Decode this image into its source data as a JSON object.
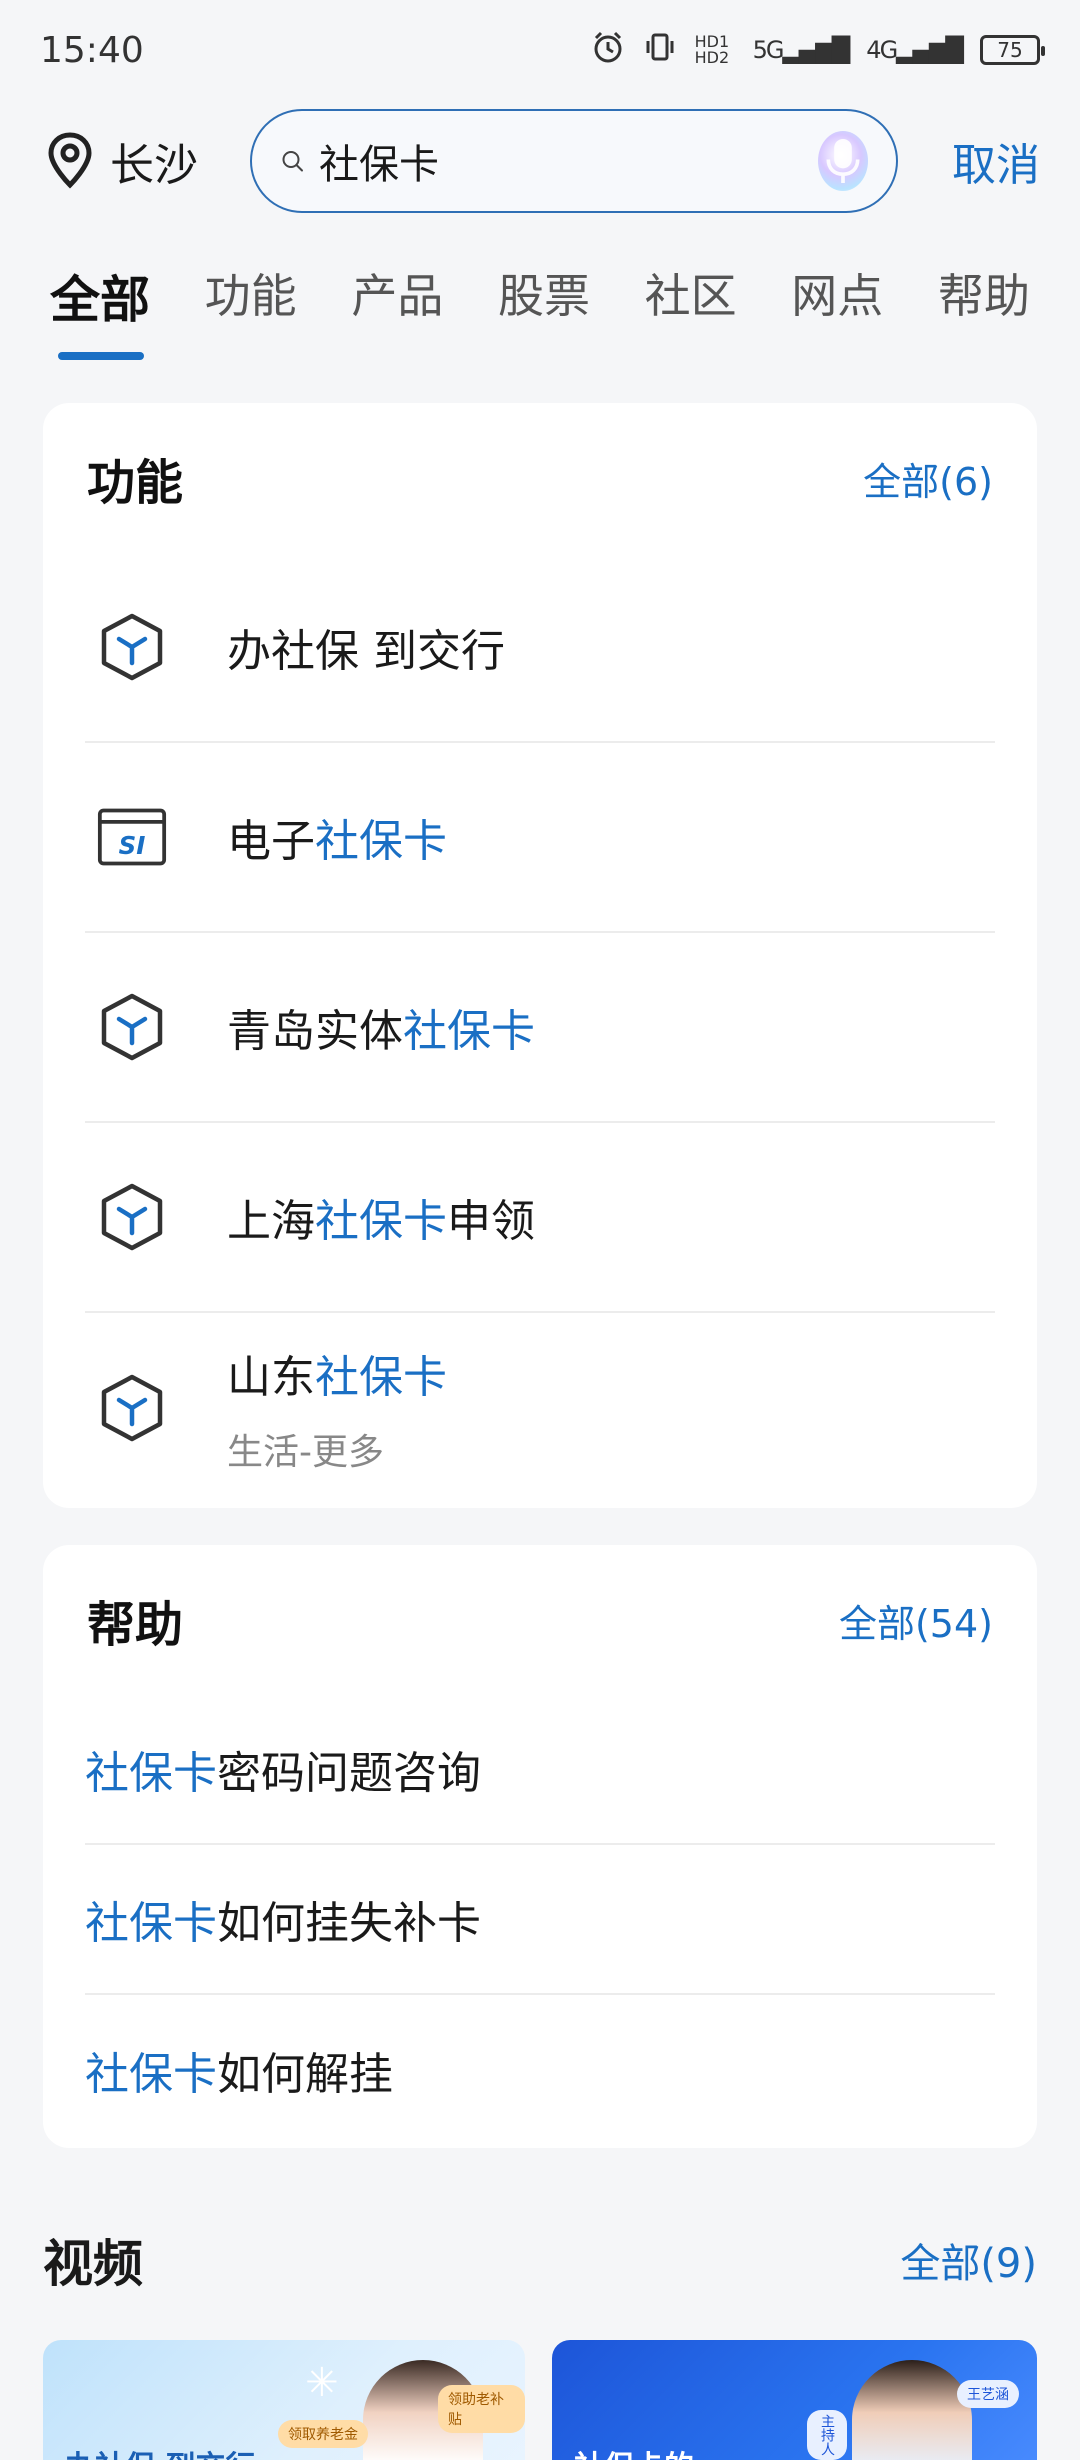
{
  "status": {
    "time": "15:40",
    "hd": "HD1 HD2",
    "net5g": "5G",
    "net4g": "4G",
    "battery": "75"
  },
  "search": {
    "location": "长沙",
    "query": "社保卡",
    "cancel_label": "取消"
  },
  "tabs": [
    "全部",
    "功能",
    "产品",
    "股票",
    "社区",
    "网点",
    "帮助"
  ],
  "functions": {
    "title": "功能",
    "more_label": "全部(6)",
    "items": [
      {
        "pre": "办社保 到交行",
        "hl": "",
        "post": "",
        "sub": "",
        "icon": "cube-icon"
      },
      {
        "pre": "电子",
        "hl": "社保卡",
        "post": "",
        "sub": "",
        "icon": "si-card-icon",
        "icon_text": "SI"
      },
      {
        "pre": "青岛实体",
        "hl": "社保卡",
        "post": "",
        "sub": "",
        "icon": "cube-icon"
      },
      {
        "pre": "上海",
        "hl": "社保卡",
        "post": "申领",
        "sub": "",
        "icon": "cube-icon"
      },
      {
        "pre": "山东",
        "hl": "社保卡",
        "post": "",
        "sub": "生活-更多",
        "icon": "cube-icon"
      }
    ]
  },
  "help": {
    "title": "帮助",
    "more_label": "全部(54)",
    "items": [
      {
        "hl": "社保卡",
        "post": "密码问题咨询"
      },
      {
        "hl": "社保卡",
        "post": "如何挂失补卡"
      },
      {
        "hl": "社保卡",
        "post": "如何解挂"
      }
    ]
  },
  "video": {
    "title": "视频",
    "more_label": "全部(9)",
    "cards": [
      {
        "caption": "办社保 到交行",
        "stickers": [
          "领取养老金",
          "领取养老金",
          "领助老补贴"
        ]
      },
      {
        "caption": "社保卡的",
        "stickers": [
          "主持人",
          "王艺涵"
        ]
      }
    ]
  },
  "colors": {
    "accent": "#1a6fc4",
    "background": "#f5f6f8",
    "card": "#ffffff",
    "muted_text": "#888888"
  }
}
